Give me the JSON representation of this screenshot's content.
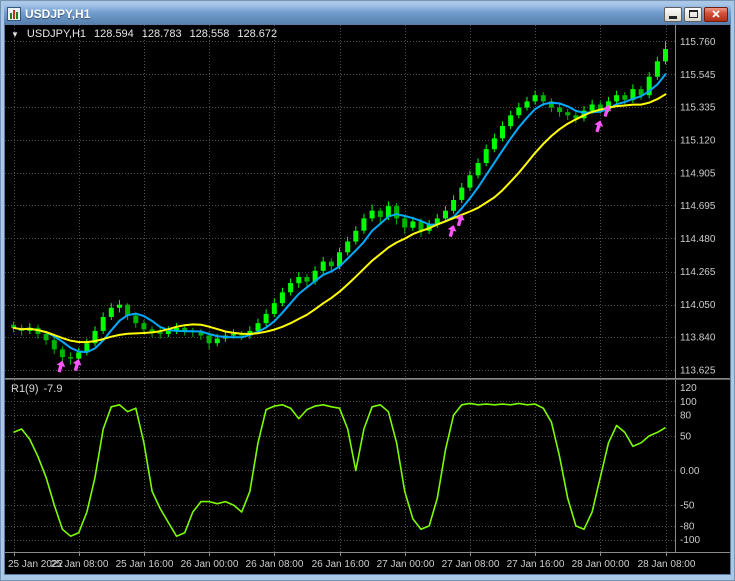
{
  "window": {
    "title": "USDJPY,H1",
    "controls": [
      "minimize",
      "maximize",
      "close"
    ]
  },
  "chart": {
    "dropdown_glyph": "▼",
    "symbol": "USDJPY,H1",
    "ohlc": {
      "open": "128.594",
      "high": "128.783",
      "low": "128.558",
      "close": "128.672"
    }
  },
  "indicator": {
    "name": "R1(9)",
    "value": "-7.9"
  },
  "price_axis": [
    "115.760",
    "115.545",
    "115.335",
    "115.120",
    "114.905",
    "114.695",
    "114.480",
    "114.265",
    "114.050",
    "113.840",
    "113.625"
  ],
  "indicator_axis": [
    "120",
    "100",
    "80",
    "50",
    "0.00",
    "-50",
    "-80",
    "-100"
  ],
  "time_axis": [
    {
      "bar": 0,
      "label": "25 Jan 2022"
    },
    {
      "bar": 8,
      "label": "25 Jan 08:00"
    },
    {
      "bar": 16,
      "label": "25 Jan 16:00"
    },
    {
      "bar": 24,
      "label": "26 Jan 00:00"
    },
    {
      "bar": 32,
      "label": "26 Jan 08:00"
    },
    {
      "bar": 40,
      "label": "26 Jan 16:00"
    },
    {
      "bar": 48,
      "label": "27 Jan 00:00"
    },
    {
      "bar": 56,
      "label": "27 Jan 08:00"
    },
    {
      "bar": 64,
      "label": "27 Jan 16:00"
    },
    {
      "bar": 72,
      "label": "28 Jan 00:00"
    },
    {
      "bar": 80,
      "label": "28 Jan 08:00"
    }
  ],
  "colors": {
    "background": "#000000",
    "grid": "#4f4f4f",
    "candle_up": "#00ff00",
    "candle_down": "#00b400",
    "ma_fast": "#00aaff",
    "ma_slow": "#ffff00",
    "oscillator": "#7cfc00",
    "signal": "#ff55ff",
    "axis_text": "#cccccc",
    "axis_line": "#8a8a8a",
    "frame": "#aac7e7"
  },
  "chart_data": {
    "type": "candlestick",
    "symbol": "USDJPY",
    "timeframe": "H1",
    "title": "USDJPY,H1",
    "price_range": [
      113.6,
      115.84
    ],
    "grid": true,
    "candles": [
      [
        113.92,
        113.94,
        113.87,
        113.9
      ],
      [
        113.9,
        113.92,
        113.85,
        113.88
      ],
      [
        113.88,
        113.93,
        113.86,
        113.9
      ],
      [
        113.9,
        113.92,
        113.83,
        113.86
      ],
      [
        113.86,
        113.88,
        113.79,
        113.82
      ],
      [
        113.82,
        113.84,
        113.73,
        113.76
      ],
      [
        113.76,
        113.78,
        113.68,
        113.71
      ],
      [
        113.71,
        113.74,
        113.66,
        113.7
      ],
      [
        113.7,
        113.77,
        113.67,
        113.74
      ],
      [
        113.74,
        113.83,
        113.72,
        113.8
      ],
      [
        113.8,
        113.91,
        113.78,
        113.88
      ],
      [
        113.88,
        114.0,
        113.86,
        113.97
      ],
      [
        113.97,
        114.06,
        113.95,
        114.03
      ],
      [
        114.03,
        114.08,
        114.0,
        114.05
      ],
      [
        114.05,
        114.06,
        113.95,
        113.98
      ],
      [
        113.98,
        114.0,
        113.9,
        113.93
      ],
      [
        113.93,
        113.95,
        113.86,
        113.89
      ],
      [
        113.89,
        113.91,
        113.84,
        113.87
      ],
      [
        113.87,
        113.9,
        113.83,
        113.86
      ],
      [
        113.86,
        113.91,
        113.84,
        113.88
      ],
      [
        113.88,
        113.93,
        113.86,
        113.9
      ],
      [
        113.9,
        113.92,
        113.85,
        113.88
      ],
      [
        113.88,
        113.9,
        113.84,
        113.87
      ],
      [
        113.87,
        113.89,
        113.82,
        113.85
      ],
      [
        113.85,
        113.87,
        113.76,
        113.8
      ],
      [
        113.8,
        113.86,
        113.78,
        113.83
      ],
      [
        113.83,
        113.88,
        113.81,
        113.85
      ],
      [
        113.85,
        113.89,
        113.83,
        113.86
      ],
      [
        113.86,
        113.88,
        113.82,
        113.85
      ],
      [
        113.85,
        113.91,
        113.83,
        113.88
      ],
      [
        113.88,
        113.96,
        113.86,
        113.93
      ],
      [
        113.93,
        114.02,
        113.91,
        113.99
      ],
      [
        113.99,
        114.09,
        113.97,
        114.06
      ],
      [
        114.06,
        114.16,
        114.04,
        114.13
      ],
      [
        114.13,
        114.22,
        114.11,
        114.19
      ],
      [
        114.19,
        114.26,
        114.16,
        114.23
      ],
      [
        114.23,
        114.25,
        114.16,
        114.2
      ],
      [
        114.2,
        114.3,
        114.18,
        114.27
      ],
      [
        114.27,
        114.36,
        114.25,
        114.33
      ],
      [
        114.33,
        114.35,
        114.26,
        114.3
      ],
      [
        114.3,
        114.42,
        114.28,
        114.39
      ],
      [
        114.39,
        114.49,
        114.37,
        114.46
      ],
      [
        114.46,
        114.56,
        114.44,
        114.53
      ],
      [
        114.53,
        114.64,
        114.51,
        114.61
      ],
      [
        114.61,
        114.7,
        114.59,
        114.66
      ],
      [
        114.66,
        114.68,
        114.58,
        114.62
      ],
      [
        114.62,
        114.72,
        114.6,
        114.69
      ],
      [
        114.69,
        114.71,
        114.57,
        114.61
      ],
      [
        114.61,
        114.63,
        114.51,
        114.55
      ],
      [
        114.55,
        114.62,
        114.53,
        114.59
      ],
      [
        114.59,
        114.61,
        114.49,
        114.53
      ],
      [
        114.53,
        114.6,
        114.51,
        114.57
      ],
      [
        114.57,
        114.64,
        114.55,
        114.61
      ],
      [
        114.61,
        114.69,
        114.59,
        114.66
      ],
      [
        114.66,
        114.76,
        114.64,
        114.73
      ],
      [
        114.73,
        114.84,
        114.71,
        114.81
      ],
      [
        114.81,
        114.92,
        114.79,
        114.89
      ],
      [
        114.89,
        115.0,
        114.87,
        114.97
      ],
      [
        114.97,
        115.09,
        114.95,
        115.06
      ],
      [
        115.06,
        115.16,
        115.04,
        115.13
      ],
      [
        115.13,
        115.24,
        115.11,
        115.21
      ],
      [
        115.21,
        115.31,
        115.19,
        115.28
      ],
      [
        115.28,
        115.36,
        115.26,
        115.33
      ],
      [
        115.33,
        115.4,
        115.31,
        115.37
      ],
      [
        115.37,
        115.44,
        115.35,
        115.41
      ],
      [
        115.41,
        115.43,
        115.34,
        115.37
      ],
      [
        115.37,
        115.39,
        115.3,
        115.33
      ],
      [
        115.33,
        115.35,
        115.27,
        115.3
      ],
      [
        115.3,
        115.32,
        115.25,
        115.28
      ],
      [
        115.28,
        115.3,
        115.23,
        115.26
      ],
      [
        115.26,
        115.34,
        115.24,
        115.31
      ],
      [
        115.31,
        115.38,
        115.29,
        115.35
      ],
      [
        115.35,
        115.37,
        115.29,
        115.32
      ],
      [
        115.32,
        115.4,
        115.3,
        115.37
      ],
      [
        115.37,
        115.44,
        115.35,
        115.41
      ],
      [
        115.41,
        115.43,
        115.35,
        115.38
      ],
      [
        115.38,
        115.48,
        115.36,
        115.45
      ],
      [
        115.45,
        115.47,
        115.38,
        115.41
      ],
      [
        115.41,
        115.56,
        115.39,
        115.53
      ],
      [
        115.53,
        115.66,
        115.51,
        115.63
      ],
      [
        115.63,
        115.76,
        115.61,
        115.71
      ]
    ],
    "overlays": [
      {
        "name": "ma-fast",
        "type": "sma",
        "period": 5,
        "color": "#00aaff"
      },
      {
        "name": "ma-slow",
        "type": "sma",
        "period": 13,
        "color": "#ffff00"
      }
    ],
    "signals": [
      {
        "bar": 6,
        "price": 113.7,
        "dir": "up"
      },
      {
        "bar": 8,
        "price": 113.71,
        "dir": "up"
      },
      {
        "bar": 54,
        "price": 114.58,
        "dir": "up"
      },
      {
        "bar": 55,
        "price": 114.65,
        "dir": "up"
      },
      {
        "bar": 72,
        "price": 115.26,
        "dir": "up"
      },
      {
        "bar": 73,
        "price": 115.36,
        "dir": "up"
      }
    ],
    "oscillator": {
      "name": "R1(9)",
      "current": -7.9,
      "range": [
        -112,
        125
      ],
      "levels": [
        100,
        80,
        50,
        0,
        -50,
        -80,
        -100
      ],
      "values": [
        55,
        60,
        45,
        20,
        -10,
        -50,
        -85,
        -95,
        -90,
        -60,
        -10,
        60,
        92,
        95,
        85,
        90,
        40,
        -30,
        -55,
        -75,
        -95,
        -90,
        -60,
        -45,
        -45,
        -48,
        -45,
        -50,
        -60,
        -30,
        40,
        88,
        93,
        95,
        90,
        75,
        88,
        93,
        95,
        92,
        90,
        60,
        0,
        60,
        92,
        95,
        85,
        40,
        -30,
        -70,
        -85,
        -80,
        -40,
        30,
        80,
        95,
        97,
        95,
        96,
        95,
        96,
        95,
        97,
        95,
        96,
        90,
        70,
        20,
        -40,
        -80,
        -85,
        -60,
        -10,
        40,
        65,
        55,
        35,
        40,
        50,
        55,
        62
      ]
    }
  }
}
